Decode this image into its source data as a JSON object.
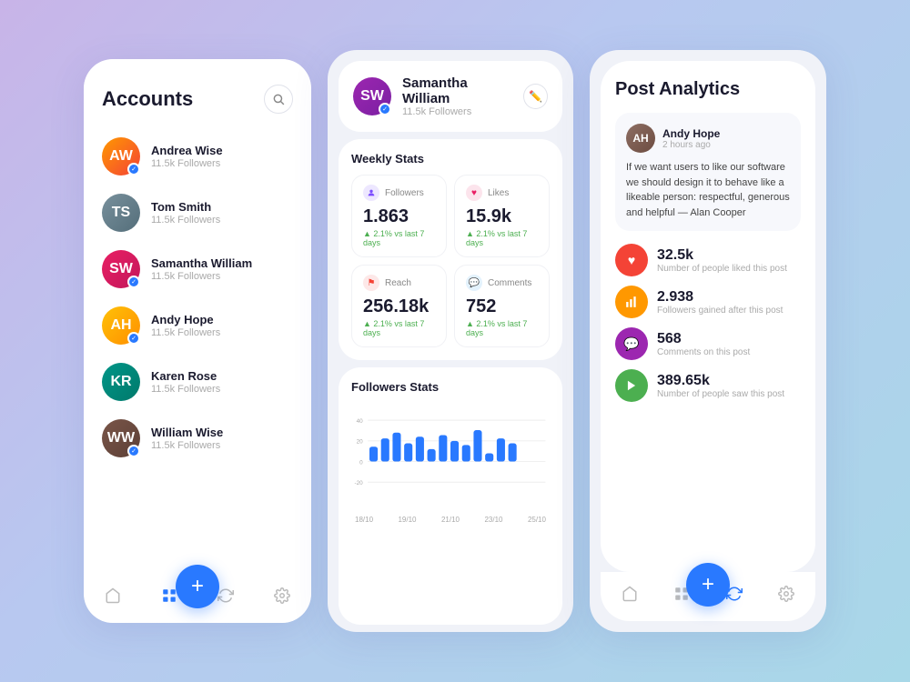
{
  "card1": {
    "title": "Accounts",
    "search_aria": "Search accounts",
    "accounts": [
      {
        "name": "Andrea Wise",
        "followers": "11.5k Followers",
        "color": "av-orange",
        "initials": "AW",
        "badge": true
      },
      {
        "name": "Tom Smith",
        "followers": "11.5k Followers",
        "color": "av-gray",
        "initials": "TS",
        "badge": false
      },
      {
        "name": "Samantha William",
        "followers": "11.5k Followers",
        "color": "av-pink",
        "initials": "SW",
        "badge": true
      },
      {
        "name": "Andy Hope",
        "followers": "11.5k Followers",
        "color": "av-amber",
        "initials": "AH",
        "badge": true
      },
      {
        "name": "Karen Rose",
        "followers": "11.5k Followers",
        "color": "av-teal",
        "initials": "KR",
        "badge": false
      },
      {
        "name": "William Wise",
        "followers": "11.5k Followers",
        "color": "av-brown",
        "initials": "WW",
        "badge": true
      }
    ],
    "fab_label": "+",
    "nav": [
      "home",
      "grid",
      "refresh",
      "settings"
    ]
  },
  "card2": {
    "profile_name": "Samantha William",
    "profile_followers": "11.5k Followers",
    "weekly_stats_title": "Weekly Stats",
    "stats": [
      {
        "key": "followers",
        "label": "Followers",
        "value": "1.863",
        "change": "2.1% vs last 7 days",
        "icon": "😊",
        "icon_class": "followers"
      },
      {
        "key": "likes",
        "label": "Likes",
        "value": "15.9k",
        "change": "2.1% vs last 7 days",
        "icon": "♥",
        "icon_class": "likes"
      },
      {
        "key": "reach",
        "label": "Reach",
        "value": "256.18k",
        "change": "2.1% vs last 7 days",
        "icon": "🚩",
        "icon_class": "reach"
      },
      {
        "key": "comments",
        "label": "Comments",
        "value": "752",
        "change": "2.1% vs last 7 days",
        "icon": "💬",
        "icon_class": "comments"
      }
    ],
    "chart_title": "Followers Stats",
    "chart_y_labels": [
      "40",
      "20",
      "0",
      "-20"
    ],
    "chart_x_labels": [
      "18/10",
      "19/10",
      "21/10",
      "23/10",
      "25/10"
    ],
    "chart_bars": [
      18,
      28,
      35,
      22,
      30,
      15,
      32,
      25,
      20,
      38,
      10,
      28,
      22
    ]
  },
  "card3": {
    "title": "Post Analytics",
    "post_author": "Andy Hope",
    "post_time": "2 hours ago",
    "post_text": "If we want users to like our software we should design it to behave like a likeable person: respectful, generous and helpful — Alan Cooper",
    "stats": [
      {
        "value": "32.5k",
        "label": "Number of people liked this post",
        "color": "red",
        "icon": "♥"
      },
      {
        "value": "2.938",
        "label": "Followers gained after this post",
        "color": "orange",
        "icon": "📊"
      },
      {
        "value": "568",
        "label": "Comments on this post",
        "color": "purple",
        "icon": "💬"
      },
      {
        "value": "389.65k",
        "label": "Number of people saw this post",
        "color": "green",
        "icon": "▶"
      }
    ],
    "fab_label": "+",
    "nav": [
      "home",
      "grid",
      "refresh",
      "settings"
    ]
  }
}
